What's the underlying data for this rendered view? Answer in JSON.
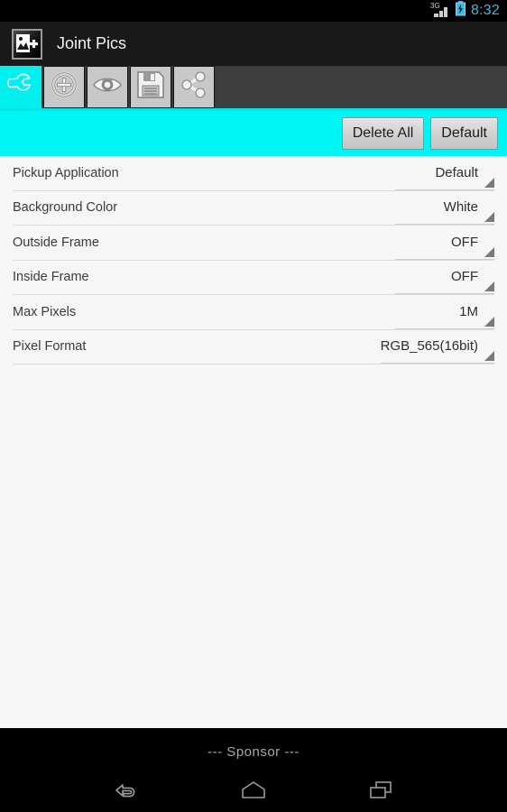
{
  "status_bar": {
    "network_type": "3G",
    "time": "8:32",
    "signal_icon": "signal-bars-icon",
    "battery_icon": "battery-charging-icon",
    "time_color": "#3fb8e0"
  },
  "title_bar": {
    "app_name": "Joint Pics",
    "app_icon": "photo-add-icon",
    "background": "#191919"
  },
  "tabs": {
    "accent_color": "#00f5f5",
    "items": [
      {
        "id": "settings",
        "icon": "wrench-icon",
        "label": "Settings",
        "active": true
      },
      {
        "id": "pickup",
        "icon": "target-plus-icon",
        "label": "Pickup",
        "active": false
      },
      {
        "id": "preview",
        "icon": "eye-icon",
        "label": "Preview",
        "active": false
      },
      {
        "id": "save",
        "icon": "floppy-disk-icon",
        "label": "Save",
        "active": false
      },
      {
        "id": "share",
        "icon": "share-nodes-icon",
        "label": "Share",
        "active": false
      }
    ]
  },
  "action_band": {
    "background": "#00f5f5",
    "delete_all_label": "Delete All",
    "default_label": "Default"
  },
  "settings": {
    "rows": [
      {
        "label": "Pickup Application",
        "value": "Default"
      },
      {
        "label": "Background Color",
        "value": "White"
      },
      {
        "label": "Outside Frame",
        "value": "OFF"
      },
      {
        "label": "Inside Frame",
        "value": "OFF"
      },
      {
        "label": "Max Pixels",
        "value": "1M"
      },
      {
        "label": "Pixel Format",
        "value": "RGB_565(16bit)"
      }
    ]
  },
  "sponsor": {
    "text": "--- Sponsor ---"
  },
  "nav_bar": {
    "back_icon": "back-arrow-icon",
    "home_icon": "home-icon",
    "recents_icon": "recents-icon"
  }
}
